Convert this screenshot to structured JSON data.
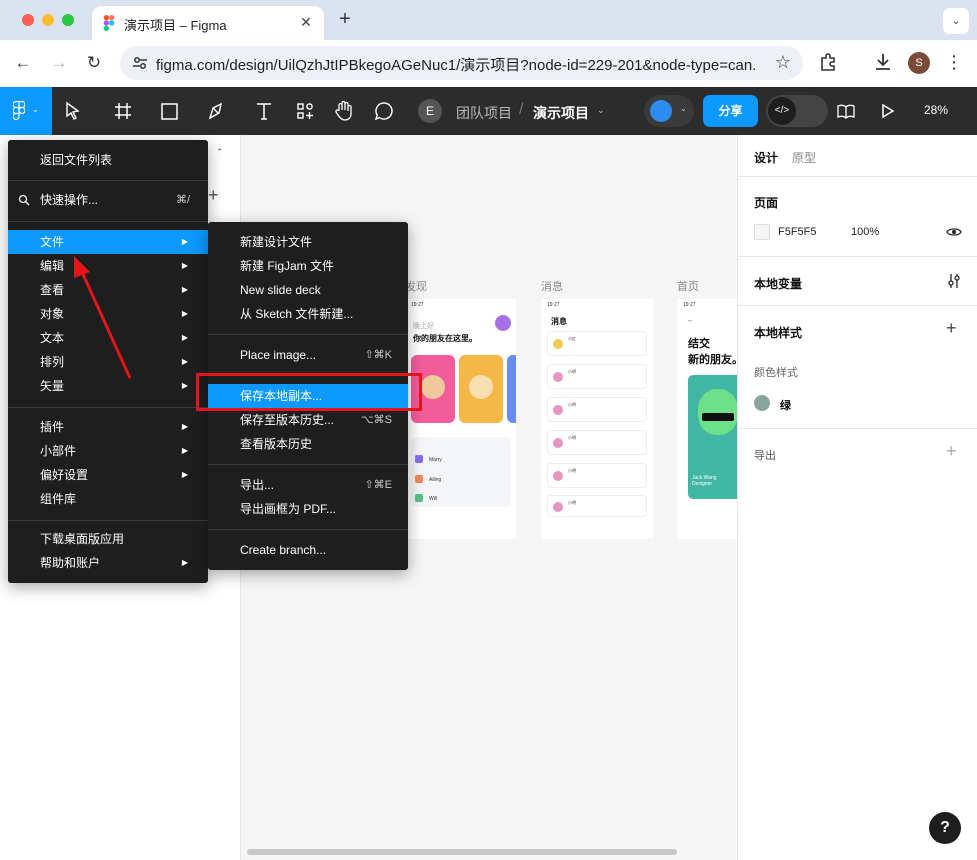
{
  "browser": {
    "tab_title": "演示项目 – Figma",
    "url": "figma.com/design/UilQzhJtIPBkegoAGeNuc1/演示项目?node-id=229-201&node-type=can...",
    "profile_initial": "S"
  },
  "toolbar": {
    "avatar_initial": "E",
    "team": "团队项目",
    "separator": "/",
    "project": "演示项目",
    "share_label": "分享",
    "zoom": "28%"
  },
  "main_menu": {
    "back": "返回文件列表",
    "quick_actions": "快速操作...",
    "quick_actions_shortcut": "⌘/",
    "items_group1": [
      {
        "label": "文件",
        "active": true
      },
      {
        "label": "编辑"
      },
      {
        "label": "查看"
      },
      {
        "label": "对象"
      },
      {
        "label": "文本"
      },
      {
        "label": "排列"
      },
      {
        "label": "矢量"
      }
    ],
    "items_group2": [
      {
        "label": "插件",
        "arrow": true
      },
      {
        "label": "小部件",
        "arrow": true
      },
      {
        "label": "偏好设置",
        "arrow": true
      },
      {
        "label": "组件库",
        "arrow": false
      }
    ],
    "items_group3": [
      {
        "label": "下载桌面版应用",
        "arrow": false
      },
      {
        "label": "帮助和账户",
        "arrow": true
      }
    ]
  },
  "file_submenu": {
    "group1": [
      {
        "label": "新建设计文件"
      },
      {
        "label": "新建 FigJam 文件"
      },
      {
        "label": "New slide deck"
      },
      {
        "label": "从 Sketch 文件新建..."
      }
    ],
    "place_image": {
      "label": "Place image...",
      "shortcut": "⇧⌘K"
    },
    "group3": [
      {
        "label": "保存本地副本...",
        "shortcut": "",
        "highlight": true
      },
      {
        "label": "保存至版本历史...",
        "shortcut": "⌥⌘S"
      },
      {
        "label": "查看版本历史",
        "shortcut": ""
      }
    ],
    "group4": [
      {
        "label": "导出...",
        "shortcut": "⇧⌘E"
      },
      {
        "label": "导出画框为 PDF...",
        "shortcut": ""
      }
    ],
    "create_branch": "Create branch..."
  },
  "canvas": {
    "frames": [
      {
        "label": "发现",
        "time": "19:27",
        "greeting": "晚上好",
        "headline": "你的朋友在这里。",
        "contacts": [
          "Marry",
          "Ailing",
          "Will"
        ]
      },
      {
        "label": "消息",
        "time": "19:27",
        "title": "消息",
        "rows": [
          "小红",
          "小明",
          "小明",
          "小明",
          "小明",
          "小明"
        ]
      },
      {
        "label": "首页",
        "time": "19:27",
        "headline_line1": "结交",
        "headline_line2": "新的朋友。",
        "card_caption": "Jack Wang\nDesigner"
      }
    ]
  },
  "right_panel": {
    "tab_design": "设计",
    "tab_prototype": "原型",
    "page_heading": "页面",
    "page_color": "F5F5F5",
    "page_opacity": "100%",
    "local_variables": "本地变量",
    "local_styles": "本地样式",
    "color_styles": "颜色样式",
    "green_style": "绿",
    "export": "导出"
  },
  "help": "?"
}
